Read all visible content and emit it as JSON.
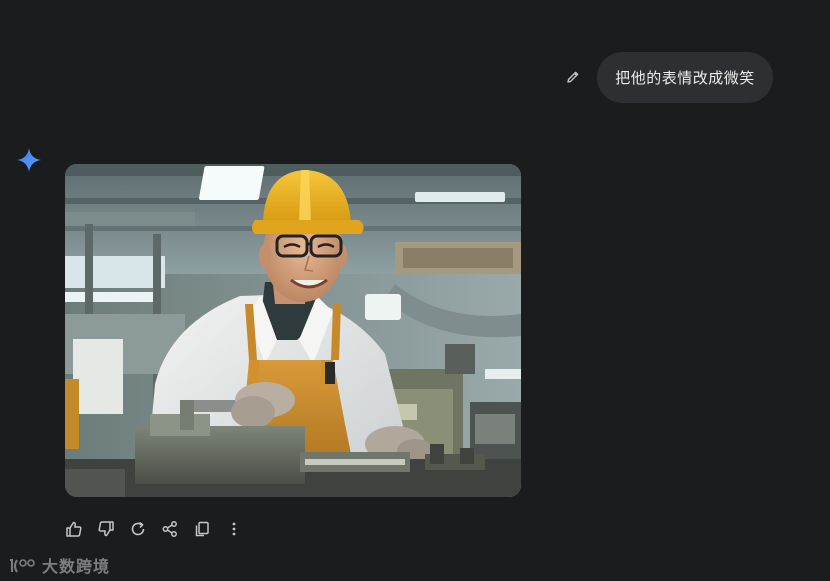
{
  "conversation": {
    "user_message": "把他的表情改成微笑"
  },
  "response": {
    "image_subject": "smiling-factory-worker"
  },
  "actions": {
    "icons": [
      "thumbs-up-icon",
      "thumbs-down-icon",
      "regenerate-icon",
      "share-icon",
      "copy-icon",
      "more-options-icon"
    ]
  },
  "watermark": {
    "text": "大数跨境"
  },
  "colors": {
    "background": "#1b1c1e",
    "bubble": "#2e2f33",
    "spark_blue": "#4f8df5",
    "icon": "#c4c7c5",
    "helmet": "#e8b32a",
    "apron": "#c8892c"
  }
}
